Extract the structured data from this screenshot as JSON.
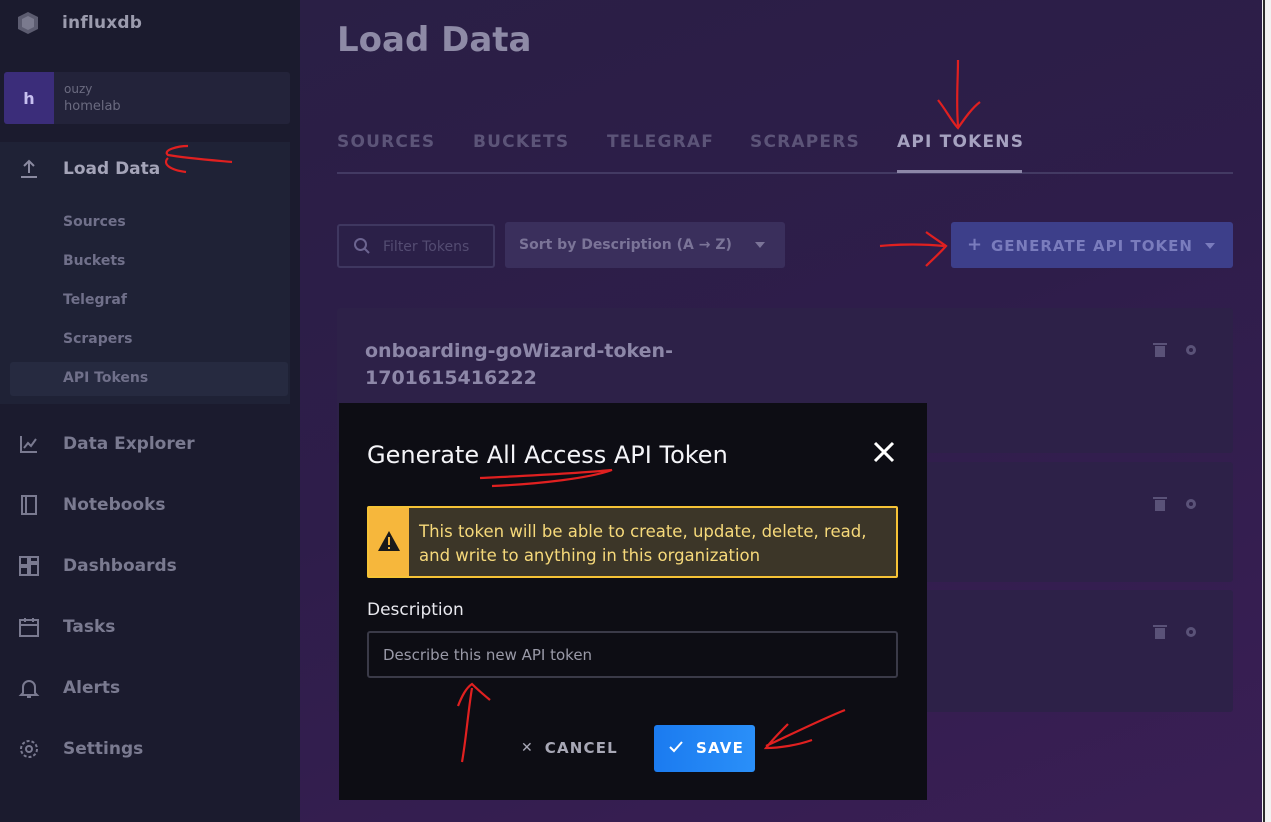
{
  "app": {
    "brand": "influxdb",
    "org": {
      "avatar_letter": "h",
      "user": "ouzy",
      "name": "homelab"
    }
  },
  "sidebar": {
    "items": [
      {
        "label": "Load Data",
        "icon": "upload-icon"
      },
      {
        "label": "Data Explorer",
        "icon": "chart-icon"
      },
      {
        "label": "Notebooks",
        "icon": "notebook-icon"
      },
      {
        "label": "Dashboards",
        "icon": "dashboard-icon"
      },
      {
        "label": "Tasks",
        "icon": "calendar-icon"
      },
      {
        "label": "Alerts",
        "icon": "bell-icon"
      },
      {
        "label": "Settings",
        "icon": "gear-icon"
      }
    ],
    "load_data_subitems": [
      "Sources",
      "Buckets",
      "Telegraf",
      "Scrapers",
      "API Tokens"
    ]
  },
  "main": {
    "title": "Load Data",
    "tabs": [
      "SOURCES",
      "BUCKETS",
      "TELEGRAF",
      "SCRAPERS",
      "API TOKENS"
    ],
    "active_tab": "API TOKENS",
    "filter_placeholder": "Filter Tokens",
    "sort_label": "Sort by Description (A → Z)",
    "generate_button": "GENERATE API TOKEN",
    "tokens": [
      {
        "name": "onboarding-goWizard-token-1701615416222"
      }
    ]
  },
  "modal": {
    "title": "Generate All Access API Token",
    "alert_text": "This token will be able to create, update, delete, read, and write to anything in this organization",
    "description_label": "Description",
    "description_placeholder": "Describe this new API token",
    "cancel_label": "CANCEL",
    "save_label": "SAVE"
  },
  "colors": {
    "accent_save": "#1b7bf0",
    "alert_yellow": "#f6c336",
    "annotation_red": "#e02020"
  }
}
